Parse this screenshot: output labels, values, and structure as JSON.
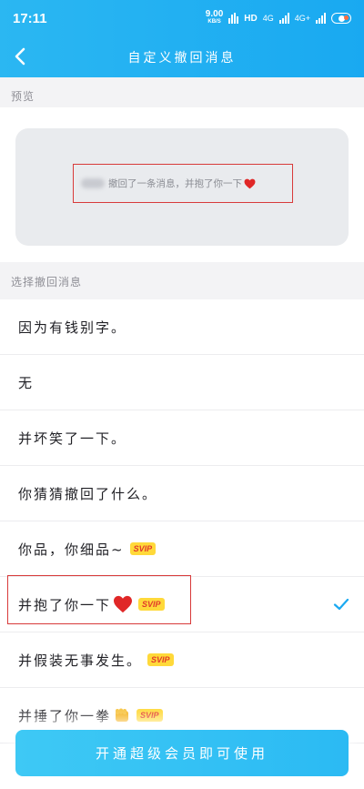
{
  "status_bar": {
    "time": "17:11",
    "speed_value": "9.00",
    "speed_unit": "KB/S",
    "hd_label": "HD",
    "network_1": "4G",
    "network_2": "4G+"
  },
  "nav": {
    "title": "自定义撤回消息"
  },
  "preview": {
    "section_label": "预览",
    "message": "撤回了一条消息，并抱了你一下"
  },
  "options": {
    "section_label": "选择撤回消息",
    "items": [
      {
        "label": "因为有钱别字。"
      },
      {
        "label": "无"
      },
      {
        "label": "并坏笑了一下。"
      },
      {
        "label": "你猜猜撤回了什么。"
      },
      {
        "label": "你品，你细品~",
        "badge": "SVIP"
      },
      {
        "label": "并抱了你一下",
        "badge": "SVIP",
        "selected": true
      },
      {
        "label": "并假装无事发生。",
        "badge": "SVIP"
      },
      {
        "label": "并捶了你一拳",
        "badge": "SVIP"
      }
    ]
  },
  "footer": {
    "button_label": "开通超级会员即可使用"
  },
  "colors": {
    "accent": "#1aa9f1",
    "selection_outline": "#d83a3a",
    "svip_bg": "#ffd93a",
    "heart": "#e02727"
  }
}
